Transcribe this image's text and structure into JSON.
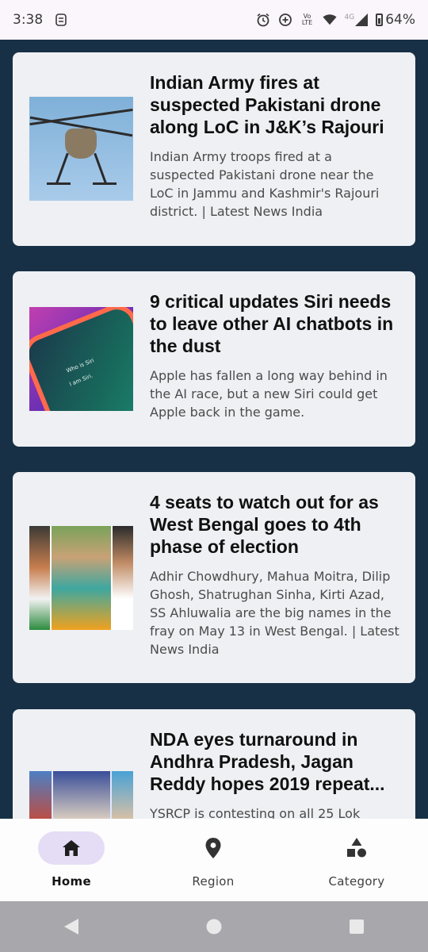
{
  "status_bar": {
    "time": "3:38",
    "volte_top": "Vo",
    "volte_bottom": "LTE",
    "network": "4G",
    "battery": "64%"
  },
  "articles": [
    {
      "title": "Indian Army fires at suspected Pakistani drone along LoC in J&K’s Rajouri",
      "description": "Indian Army troops fired at a suspected Pakistani drone near the LoC in Jammu and Kashmir's Rajouri district. | Latest News India",
      "thumbnail": "drone-photo"
    },
    {
      "title": "9 critical updates Siri needs to leave other AI chatbots in the dust",
      "description": "Apple has fallen a long way behind in the AI race, but a new Siri could get Apple back in the game.",
      "thumbnail": "siri-phone-photo",
      "thumbnail_text": [
        "Who is Siri",
        "I am Siri."
      ]
    },
    {
      "title": "4 seats to watch out for as West Bengal goes to 4th phase of election",
      "description": "Adhir Chowdhury, Mahua Moitra, Dilip Ghosh, Shatrughan Sinha, Kirti Azad, SS Ahluwalia are the big names in the fray on May 13 in West Bengal. | Latest News India",
      "thumbnail": "candidates-collage"
    },
    {
      "title": "NDA eyes turnaround in Andhra Pradesh, Jagan Reddy hopes 2019 repeat...",
      "description": "YSRCP is contesting on all 25 Lok",
      "thumbnail": "rally-collage"
    }
  ],
  "bottom_nav": {
    "items": [
      {
        "label": "Home",
        "icon": "home-icon",
        "active": true
      },
      {
        "label": "Region",
        "icon": "location-pin-icon",
        "active": false
      },
      {
        "label": "Category",
        "icon": "category-shapes-icon",
        "active": false
      }
    ]
  },
  "colors": {
    "background": "#173046",
    "card": "#eef0f3",
    "active_pill": "#e4ddf5",
    "status_bar": "#fbf5fc",
    "system_nav": "#a8a7ab"
  }
}
